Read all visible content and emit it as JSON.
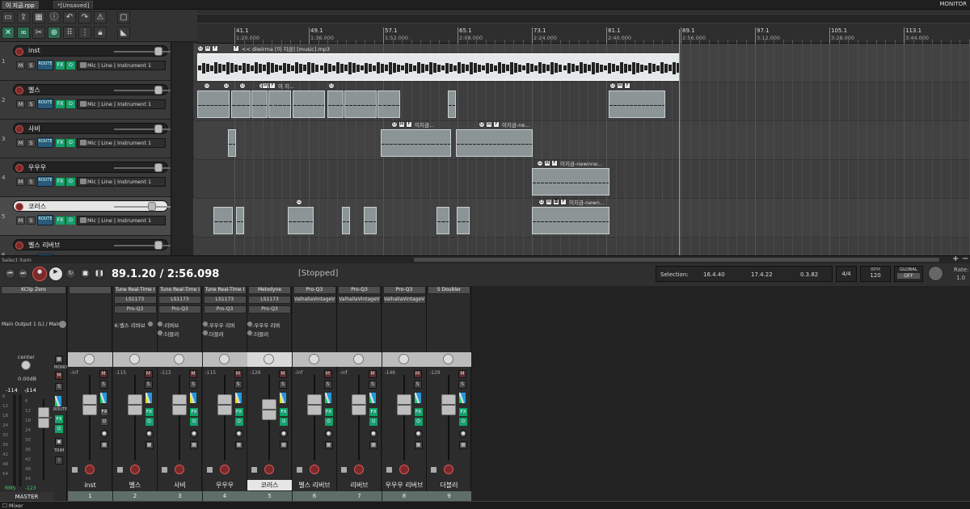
{
  "window": {
    "tabs": [
      {
        "label": "이 지금.rpp"
      },
      {
        "label": "*[Unsaved]"
      }
    ],
    "monitor_label": "MONITOR"
  },
  "ruler": {
    "bars": [
      "41.1",
      "49.1",
      "57.1",
      "65.1",
      "73.1",
      "81.1",
      "89.1",
      "97.1",
      "105.1",
      "113.1"
    ],
    "times": [
      "1:20.000",
      "1:36.000",
      "1:52.000",
      "2:08.000",
      "2:24.000",
      "2:40.000",
      "2:56.000",
      "3:12.000",
      "3:28.000",
      "3:44.000"
    ]
  },
  "tracks": [
    {
      "num": "1",
      "name": "inst",
      "input": "Mic | Line | Instrument 1",
      "selected": false,
      "fx_active": true
    },
    {
      "num": "2",
      "name": "벨스",
      "input": "Mic | Line | Instrument 1",
      "selected": false,
      "fx_active": true
    },
    {
      "num": "3",
      "name": "사비",
      "input": "Mic | Line | Instrument 1",
      "selected": false,
      "fx_active": true
    },
    {
      "num": "4",
      "name": "우우우",
      "input": "Mic | Line | Instrument 1",
      "selected": false,
      "fx_active": true
    },
    {
      "num": "5",
      "name": "코러스",
      "input": "Mic | Line | Instrument 1",
      "selected": true,
      "fx_active": true
    },
    {
      "num": "6",
      "name": "벨스 리버브",
      "input": "",
      "selected": false,
      "fx_active": false
    }
  ],
  "track_buttons": {
    "mute": "M",
    "solo": "S",
    "route": "ROUTE",
    "fx": "FX"
  },
  "items": {
    "inst_label": "<< diwirma [이 지금] [music].mp3",
    "sabi_label_1": "이지금...",
    "sabi_label_2": "이지금-ne...",
    "uuu_label": "이지금-newnne...",
    "chorus_label": "이지금-newn...",
    "bells_label": "이 지..."
  },
  "transport": {
    "select_label": "Select item",
    "position": "89.1.20 / 2:56.098",
    "status": "[Stopped]",
    "selection_label": "Selection:",
    "sel_start": "16.4.40",
    "sel_end": "17.4.22",
    "sel_len": "0.3.82",
    "time_sig": "4/4",
    "bpm_label": "BPM",
    "bpm": "120",
    "global_label": "GLOBAL",
    "global_value": "OFF",
    "rate_label": "Rate:",
    "rate": "1.0"
  },
  "master": {
    "fx": "KClip Zero",
    "output": "Main Output 1 (L) / Main",
    "pan_label": "center",
    "volume": "0.00dB",
    "peak_l": "-114",
    "peak_r": "-114",
    "mono": "MONO",
    "route": "ROUTE",
    "fx_btn": "FX",
    "trim": "TRIM",
    "info": "i",
    "rms_label": "RMS",
    "rms": "-123",
    "name": "MASTER",
    "scale": [
      "6",
      "12",
      "18",
      "24",
      "30",
      "36",
      "42",
      "48",
      "54"
    ],
    "scale_right": [
      "0",
      "6",
      "12",
      "18",
      "24",
      "30",
      "36",
      "42",
      "48",
      "54"
    ]
  },
  "mixer": [
    {
      "num": "1",
      "name": "inst",
      "db": "-inf",
      "fx": [
        "",
        "",
        ""
      ],
      "sends": [],
      "selected": false,
      "fx_active": false,
      "stripe": "g"
    },
    {
      "num": "2",
      "name": "벨스",
      "db": "-115",
      "fx": [
        "Tune Real-Time I",
        "LS1173",
        "Pro-Q3"
      ],
      "sends": [
        "6:벨스 리버브"
      ],
      "selected": false,
      "fx_active": true,
      "stripe": "y"
    },
    {
      "num": "3",
      "name": "사비",
      "db": "-113",
      "fx": [
        "Tune Real-Time I",
        "LS1173",
        "Pro-Q3"
      ],
      "sends": [
        "7:리버브",
        "9:더블러"
      ],
      "selected": false,
      "fx_active": true,
      "stripe": "y"
    },
    {
      "num": "4",
      "name": "우우우",
      "db": "-115",
      "fx": [
        "Tune Real-Time I",
        "LS1173",
        "Pro-Q3"
      ],
      "sends": [
        "8:우우우 리버",
        "9:더블러"
      ],
      "selected": false,
      "fx_active": true,
      "stripe": "y"
    },
    {
      "num": "5",
      "name": "코러스",
      "db": "-126",
      "fx": [
        "Melodyne",
        "LS1173",
        "Pro-Q3"
      ],
      "sends": [
        "8:우우우 리버",
        "9:더블러"
      ],
      "selected": true,
      "fx_active": true,
      "stripe": "y"
    },
    {
      "num": "6",
      "name": "벨스 리버브",
      "db": "-inf",
      "fx": [
        "Pro-Q3",
        "ValhallaVintageV",
        ""
      ],
      "sends": [],
      "selected": false,
      "fx_active": true,
      "stripe": "g"
    },
    {
      "num": "7",
      "name": "리버브",
      "db": "-inf",
      "fx": [
        "Pro-Q3",
        "ValhallaVintageV",
        ""
      ],
      "sends": [],
      "selected": false,
      "fx_active": true,
      "stripe": "g"
    },
    {
      "num": "8",
      "name": "우우우 리버브",
      "db": "-146",
      "fx": [
        "Pro-Q3",
        "ValhallaVintageV",
        ""
      ],
      "sends": [],
      "selected": false,
      "fx_active": true,
      "stripe": "g"
    },
    {
      "num": "9",
      "name": "더블러",
      "db": "-129",
      "fx": [
        "S Doubler",
        "",
        ""
      ],
      "sends": [],
      "selected": false,
      "fx_active": true,
      "stripe": "g"
    }
  ],
  "mixer_buttons": {
    "mute": "M",
    "solo": "S",
    "fx": "FX"
  },
  "footer": {
    "label": "Mixer"
  }
}
